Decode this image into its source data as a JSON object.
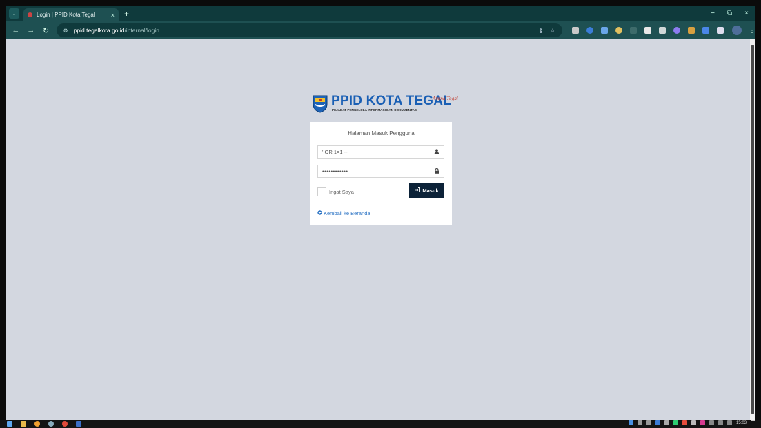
{
  "browser": {
    "tab_title": "Login | PPID Kota Tegal",
    "tab_close": "×",
    "new_tab": "+",
    "url_host": "ppid.tegalkota.go.id",
    "url_path": "/internal/login",
    "window_controls": [
      "−",
      "⧉",
      "×"
    ]
  },
  "brand": {
    "name": "PPID KOTA TEGAL",
    "subtitle": "PEJABAT PENGELOLA INFORMASI DAN DOKUMENTASI",
    "tagline": "Aruna Tegal"
  },
  "login": {
    "heading": "Halaman Masuk Pengguna",
    "username_value": "' OR 1=1 --",
    "password_value": "••••••••••••",
    "remember_label": "Ingat Saya",
    "submit_label": "Masuk",
    "back_link": "Kembali ke Beranda"
  },
  "taskbar": {
    "time": "15:03"
  },
  "colors": {
    "chrome_dark": "#0f3a3c",
    "chrome_light": "#1e5052",
    "page_bg": "#d3d7e0",
    "brand_blue": "#1a5fb4",
    "button_bg": "#0c2238",
    "link": "#2b73c4"
  },
  "icons": {
    "username_field": "user-icon",
    "password_field": "lock-icon",
    "submit_button": "sign-in-icon",
    "back_link": "arrow-circle-left-icon"
  }
}
